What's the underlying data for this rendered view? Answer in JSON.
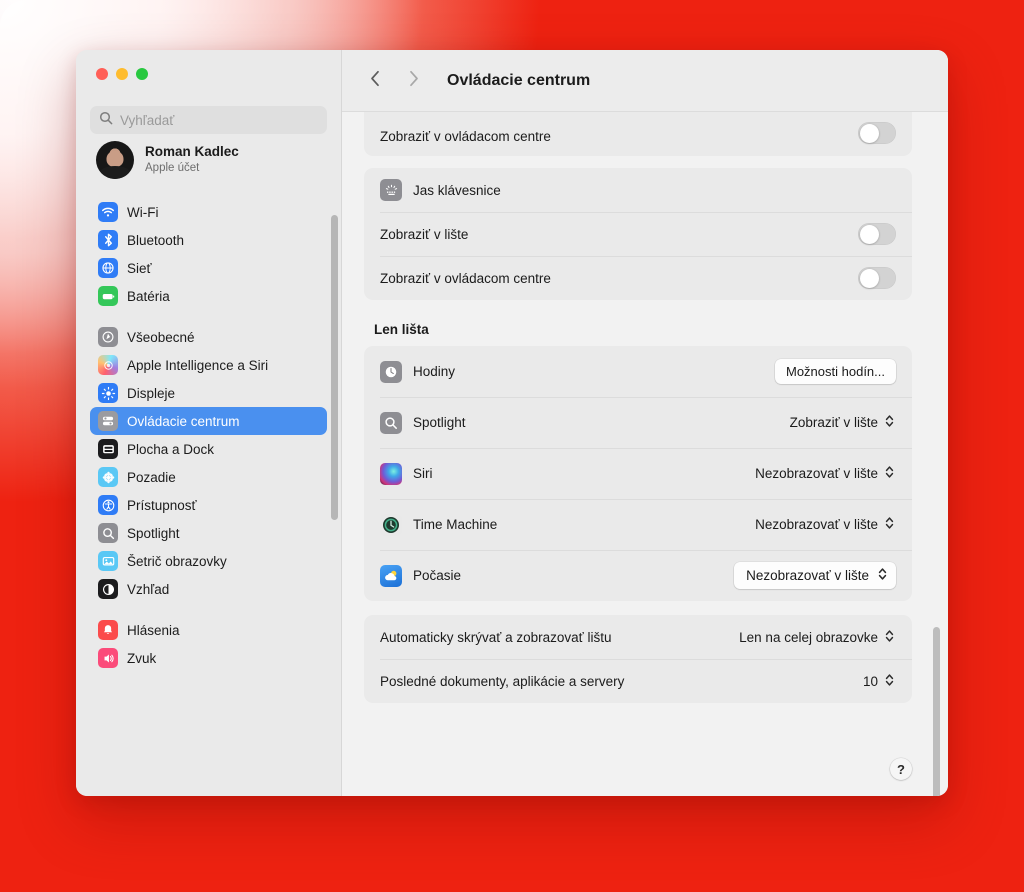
{
  "window": {
    "traffic_lights": [
      "close",
      "minimize",
      "zoom"
    ],
    "colors": {
      "accent": "#4a90ef",
      "close": "#ff5f57",
      "minimize": "#febc2e",
      "zoom": "#28c840",
      "desktop_bg": "#ee2010"
    }
  },
  "sidebar": {
    "search": {
      "placeholder": "Vyhľadať",
      "value": "",
      "icon": "search-icon"
    },
    "account": {
      "name": "Roman Kadlec",
      "subtitle": "Apple účet",
      "avatar": "user-avatar"
    },
    "groups": [
      {
        "items": [
          {
            "label": "Wi-Fi",
            "icon": "wifi-icon",
            "selected": false
          },
          {
            "label": "Bluetooth",
            "icon": "bluetooth-icon",
            "selected": false
          },
          {
            "label": "Sieť",
            "icon": "network-globe-icon",
            "selected": false
          },
          {
            "label": "Batéria",
            "icon": "battery-icon",
            "selected": false
          }
        ]
      },
      {
        "items": [
          {
            "label": "Všeobecné",
            "icon": "general-gear-icon",
            "selected": false
          },
          {
            "label": "Apple Intelligence a Siri",
            "icon": "apple-intelligence-icon",
            "selected": false
          },
          {
            "label": "Displeje",
            "icon": "displays-brightness-icon",
            "selected": false
          },
          {
            "label": "Ovládacie centrum",
            "icon": "control-center-icon",
            "selected": true
          },
          {
            "label": "Plocha a Dock",
            "icon": "desktop-dock-icon",
            "selected": false
          },
          {
            "label": "Pozadie",
            "icon": "wallpaper-icon",
            "selected": false
          },
          {
            "label": "Prístupnosť",
            "icon": "accessibility-icon",
            "selected": false
          },
          {
            "label": "Spotlight",
            "icon": "spotlight-search-icon",
            "selected": false
          },
          {
            "label": "Šetrič obrazovky",
            "icon": "screen-saver-icon",
            "selected": false
          },
          {
            "label": "Vzhľad",
            "icon": "appearance-icon",
            "selected": false
          }
        ]
      },
      {
        "items": [
          {
            "label": "Hlásenia",
            "icon": "notifications-bell-icon",
            "selected": false
          },
          {
            "label": "Zvuk",
            "icon": "sound-speaker-icon",
            "selected": false
          }
        ]
      }
    ]
  },
  "toolbar": {
    "back_icon": "chevron-left-icon",
    "forward_icon": "chevron-right-icon",
    "title": "Ovládacie centrum"
  },
  "main": {
    "top_partial_row": {
      "label": "Zobraziť v ovládacom centre",
      "toggle_state": "off"
    },
    "keyboard_card": {
      "header": {
        "label": "Jas klávesnice",
        "icon": "keyboard-brightness-icon"
      },
      "rows": [
        {
          "label": "Zobraziť v lište",
          "toggle_state": "off"
        },
        {
          "label": "Zobraziť v ovládacom centre",
          "toggle_state": "off"
        }
      ]
    },
    "menubar_section": {
      "heading": "Len lišta",
      "rows": [
        {
          "label": "Hodiny",
          "icon": "clock-icon",
          "control": "button",
          "value": "Možnosti hodín..."
        },
        {
          "label": "Spotlight",
          "icon": "spotlight-search-icon",
          "control": "popup",
          "value": "Zobraziť v lište"
        },
        {
          "label": "Siri",
          "icon": "siri-orb-icon",
          "control": "popup",
          "value": "Nezobrazovať v lište"
        },
        {
          "label": "Time Machine",
          "icon": "time-machine-icon",
          "control": "popup",
          "value": "Nezobrazovať v lište"
        },
        {
          "label": "Počasie",
          "icon": "weather-icon",
          "control": "popup-bezel",
          "value": "Nezobrazovať v lište"
        }
      ]
    },
    "bottom_card": {
      "rows": [
        {
          "label": "Automaticky skrývať a zobrazovať lištu",
          "control": "popup",
          "value": "Len na celej obrazovke"
        },
        {
          "label": "Posledné dokumenty, aplikácie a servery",
          "control": "popup",
          "value": "10"
        }
      ]
    },
    "help_button": {
      "label": "?",
      "icon": "help-question-icon"
    }
  }
}
